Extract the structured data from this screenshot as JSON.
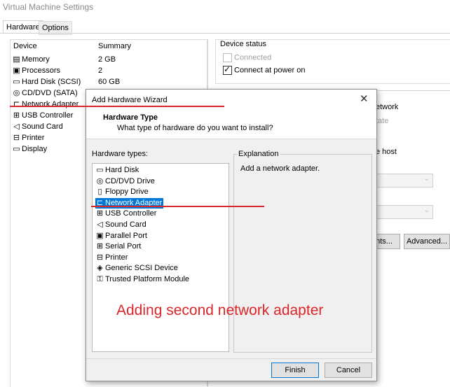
{
  "window": {
    "title": "Virtual Machine Settings",
    "tabs": [
      "Hardware",
      "Options"
    ]
  },
  "device_list": {
    "col_device": "Device",
    "col_summary": "Summary",
    "rows": [
      {
        "icon": "memory-icon",
        "glyph": "▤",
        "name": "Memory",
        "summary": "2 GB"
      },
      {
        "icon": "processors-icon",
        "glyph": "▣",
        "name": "Processors",
        "summary": "2"
      },
      {
        "icon": "hard-disk-icon",
        "glyph": "▭",
        "name": "Hard Disk (SCSI)",
        "summary": "60 GB"
      },
      {
        "icon": "cd-dvd-icon",
        "glyph": "◎",
        "name": "CD/DVD (SATA)",
        "summary": ""
      },
      {
        "icon": "network-adapter-icon",
        "glyph": "⊏",
        "name": "Network Adapter",
        "summary": ""
      },
      {
        "icon": "usb-controller-icon",
        "glyph": "⊞",
        "name": "USB Controller",
        "summary": ""
      },
      {
        "icon": "sound-card-icon",
        "glyph": "◁",
        "name": "Sound Card",
        "summary": ""
      },
      {
        "icon": "printer-icon",
        "glyph": "⊟",
        "name": "Printer",
        "summary": ""
      },
      {
        "icon": "display-icon",
        "glyph": "▭",
        "name": "Display",
        "summary": ""
      }
    ]
  },
  "device_status": {
    "title": "Device status",
    "connected": "Connected",
    "connect_at_power_on": "Connect at power on"
  },
  "bg_fragments": {
    "network": "etwork",
    "state": "tate",
    "host": "e host",
    "advanced_partial": "ents...",
    "advanced": "Advanced..."
  },
  "wizard": {
    "title": "Add Hardware Wizard",
    "close": "✕",
    "header_title": "Hardware Type",
    "header_subtitle": "What type of hardware do you want to install?",
    "hardware_types_label": "Hardware types:",
    "explanation_label": "Explanation",
    "explanation_text": "Add a network adapter.",
    "items": [
      {
        "icon": "hard-disk-icon",
        "glyph": "▭",
        "label": "Hard Disk"
      },
      {
        "icon": "cd-dvd-icon",
        "glyph": "◎",
        "label": "CD/DVD Drive"
      },
      {
        "icon": "floppy-icon",
        "glyph": "▯",
        "label": "Floppy Drive"
      },
      {
        "icon": "network-adapter-icon",
        "glyph": "⊏",
        "label": "Network Adapter"
      },
      {
        "icon": "usb-controller-icon",
        "glyph": "⊞",
        "label": "USB Controller"
      },
      {
        "icon": "sound-card-icon",
        "glyph": "◁",
        "label": "Sound Card"
      },
      {
        "icon": "parallel-port-icon",
        "glyph": "▣",
        "label": "Parallel Port"
      },
      {
        "icon": "serial-port-icon",
        "glyph": "⊞",
        "label": "Serial Port"
      },
      {
        "icon": "printer-icon",
        "glyph": "⊟",
        "label": "Printer"
      },
      {
        "icon": "scsi-device-icon",
        "glyph": "◈",
        "label": "Generic SCSI Device"
      },
      {
        "icon": "tpm-icon",
        "glyph": "⚿",
        "label": "Trusted Platform Module"
      }
    ],
    "selected_index": 3,
    "finish": "Finish",
    "cancel": "Cancel"
  },
  "annotation": {
    "text": "Adding second network adapter",
    "color": "#d9262a"
  },
  "colors": {
    "selection": "#0078d7",
    "dialog_bg": "#f0f0f0"
  }
}
